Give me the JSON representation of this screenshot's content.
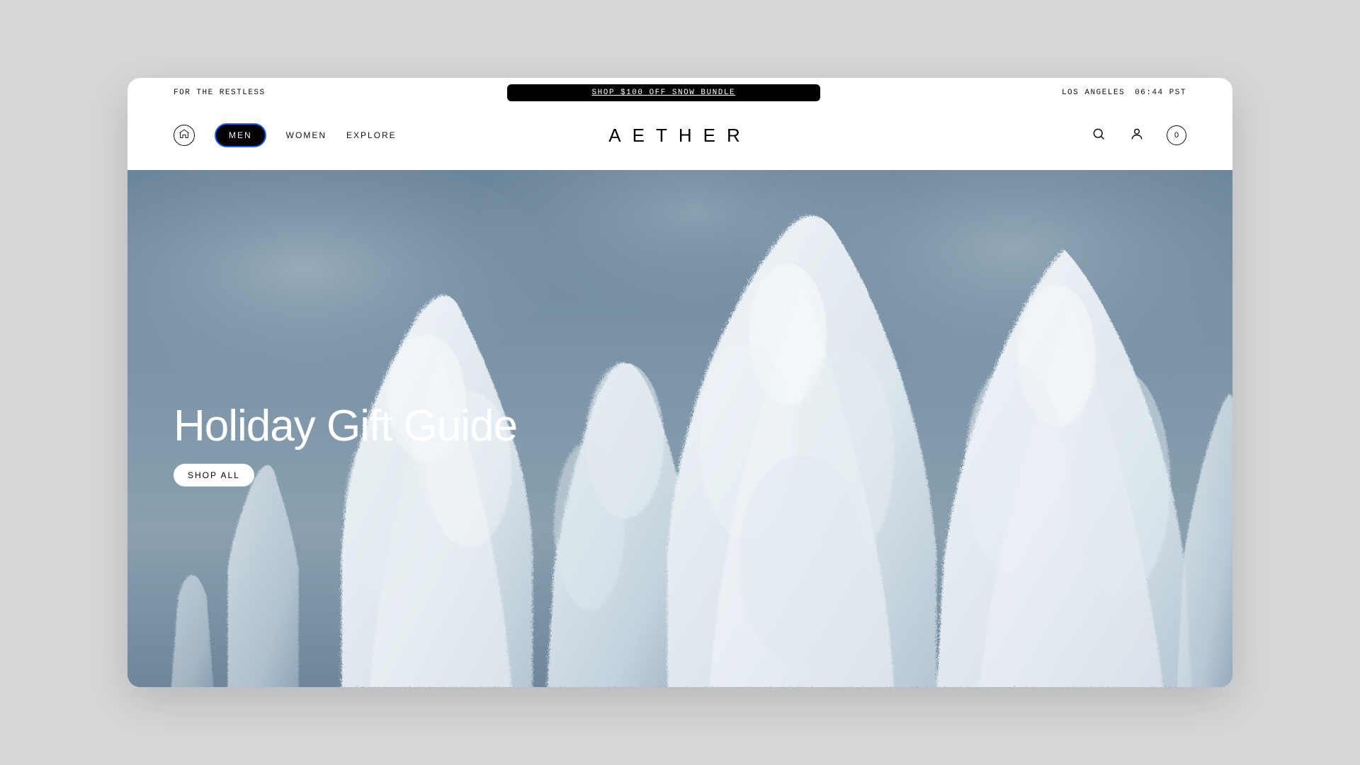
{
  "topbar": {
    "tagline": "FOR THE RESTLESS",
    "promo_label": "SHOP $100 OFF SNOW BUNDLE",
    "location": "LOS ANGELES",
    "time": "06:44 PST"
  },
  "nav": {
    "items": [
      {
        "label": "MEN",
        "active": true
      },
      {
        "label": "WOMEN",
        "active": false
      },
      {
        "label": "EXPLORE",
        "active": false
      }
    ],
    "brand": "AETHER",
    "cart_count": "0"
  },
  "hero": {
    "title": "Holiday Gift Guide",
    "cta_label": "SHOP ALL"
  }
}
